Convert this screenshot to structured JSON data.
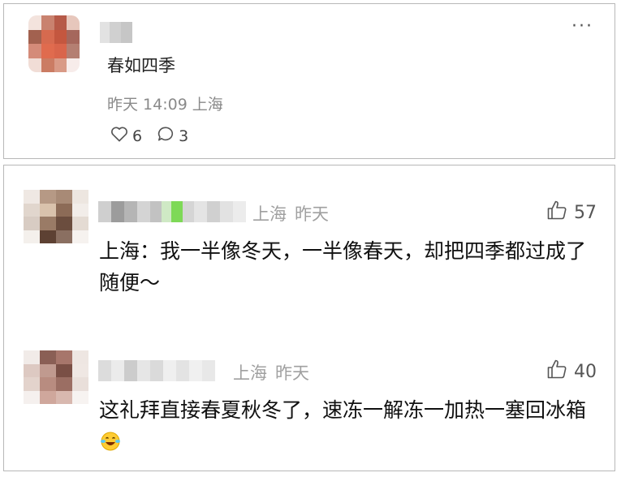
{
  "post": {
    "text": "春如四季",
    "time": "昨天 14:09",
    "location": "上海",
    "likes": "6",
    "comments": "3",
    "more_label": "···"
  },
  "comments": [
    {
      "location": "上海",
      "time": "昨天",
      "likes": "57",
      "text": "上海：我一半像冬天，一半像春天，却把四季都过成了随便～"
    },
    {
      "location": "上海",
      "time": "昨天",
      "likes": "40",
      "text": "这礼拜直接春夏秋冬了，速冻一解冻一加热一塞回冰箱",
      "emoji": "laughing-tears-emoji"
    }
  ],
  "icons": {
    "heart": "heart-icon",
    "comment": "comment-bubble-icon",
    "thumb": "thumbs-up-icon",
    "more": "more-dots-icon"
  },
  "colors": {
    "meta_gray": "#8a8a8a",
    "border": "#b8b8b8",
    "blur_green": "#7ed957"
  }
}
